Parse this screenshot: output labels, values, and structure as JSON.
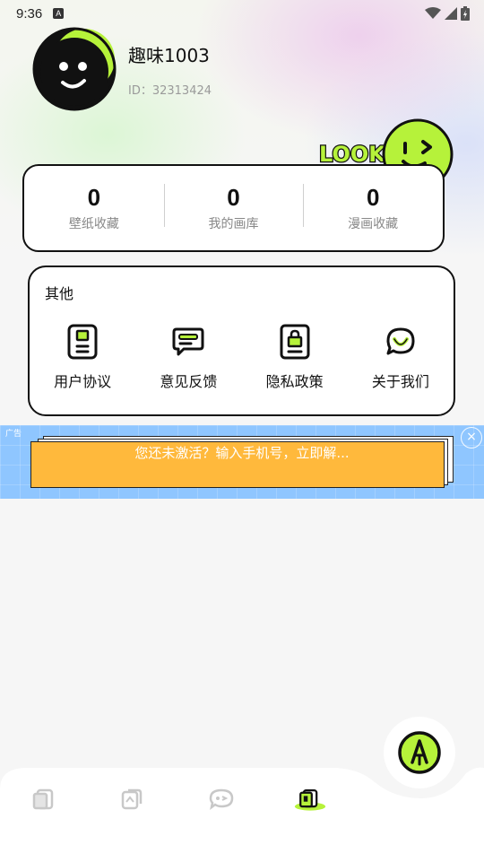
{
  "status_bar": {
    "time": "9:36",
    "notif_icon": "A"
  },
  "profile": {
    "name": "趣味1003",
    "id_text": "ID：32313424"
  },
  "badge": {
    "text": "LOOK"
  },
  "stats": [
    {
      "value": "0",
      "label": "壁纸收藏"
    },
    {
      "value": "0",
      "label": "我的画库"
    },
    {
      "value": "0",
      "label": "漫画收藏"
    }
  ],
  "other": {
    "title": "其他",
    "items": [
      {
        "label": "用户协议",
        "icon": "document-icon"
      },
      {
        "label": "意见反馈",
        "icon": "chat-bubble-icon"
      },
      {
        "label": "隐私政策",
        "icon": "lock-document-icon"
      },
      {
        "label": "关于我们",
        "icon": "smile-chat-icon"
      }
    ]
  },
  "ad": {
    "tag": "广告",
    "text": "您还未激活？输入手机号，立即解...",
    "close": "×"
  },
  "nav": {
    "items": [
      {
        "icon": "wallpaper-icon",
        "active": false
      },
      {
        "icon": "gallery-icon",
        "active": false
      },
      {
        "icon": "comic-icon",
        "active": false
      },
      {
        "icon": "profile-book-icon",
        "active": true
      }
    ]
  },
  "colors": {
    "accent_green": "#b6f23a",
    "dark": "#111111",
    "ad_orange": "#ffb93c",
    "ad_blue": "#8fc6ff"
  }
}
